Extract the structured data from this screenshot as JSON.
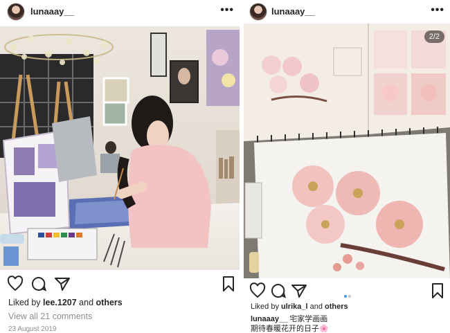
{
  "left_post": {
    "username": "lunaaay__",
    "more_label": "•••",
    "liked_by_prefix": "Liked by ",
    "liked_by_user": "lee.1207",
    "liked_by_suffix": " and ",
    "liked_by_others": "others",
    "view_comments": "View all 21 comments",
    "date": "23 August 2019"
  },
  "right_post": {
    "username": "lunaaay__",
    "more_label": "•••",
    "counter": "2/2",
    "liked_by_prefix": "Liked by ",
    "liked_by_user": "ulrika_l",
    "liked_by_suffix": " and ",
    "liked_by_others": "others",
    "caption_user": "lunaaay__",
    "caption_text": " 宅家学画画",
    "caption_line2": "期待春暖花开的日子🌸",
    "dots_count": 2,
    "active_dot": 1
  },
  "colors": {
    "text": "#262626",
    "muted": "#8e8e8e",
    "accent_dot": "#3897f0"
  },
  "icons": [
    "heart-icon",
    "comment-icon",
    "share-icon",
    "bookmark-icon",
    "more-icon"
  ]
}
